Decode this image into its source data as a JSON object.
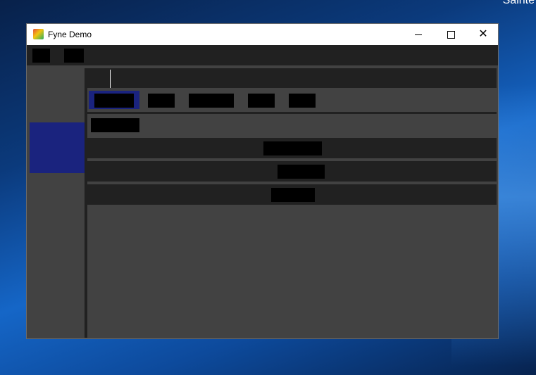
{
  "desktop": {
    "corner_text": "Sainte"
  },
  "window": {
    "title": "Fyne Demo",
    "app_icon": "fyne-logo-icon",
    "controls": {
      "minimize_icon": "minimize-icon",
      "maximize_icon": "maximize-icon",
      "close_icon": "close-icon"
    }
  },
  "menu": {
    "items": [
      "",
      ""
    ]
  },
  "sidebar": {
    "items": [
      {
        "label": ""
      },
      {
        "label": "",
        "selected": true
      },
      {
        "label": ""
      },
      {
        "label": ""
      },
      {
        "label": ""
      }
    ]
  },
  "main": {
    "entry": {
      "value": "",
      "placeholder": ""
    },
    "tabs": [
      {
        "label": "",
        "selected": true
      },
      {
        "label": ""
      },
      {
        "label": ""
      },
      {
        "label": ""
      },
      {
        "label": ""
      }
    ],
    "sub_button": "",
    "rows": [
      {
        "label": ""
      },
      {
        "label": ""
      },
      {
        "label": ""
      }
    ]
  },
  "colors": {
    "window_bg": "#424242",
    "menubar_bg": "#212121",
    "selected_bg": "#1a237e",
    "row_bg": "#212121",
    "titlebar_bg": "#ffffff"
  }
}
